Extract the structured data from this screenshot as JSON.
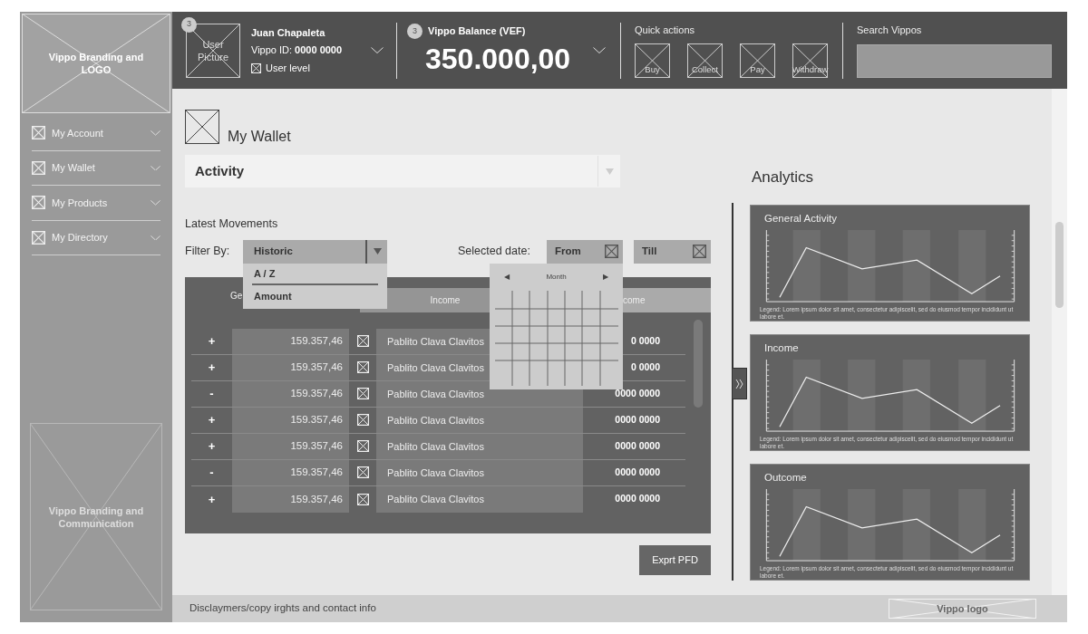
{
  "sidebar": {
    "logo": "Vippo Branding and LOGO",
    "items": [
      {
        "label": "My Account"
      },
      {
        "label": "My Wallet"
      },
      {
        "label": "My Products"
      },
      {
        "label": "My Directory"
      }
    ],
    "banner": "Vippo Branding and Communication"
  },
  "header": {
    "user": {
      "picture_label": "User Picture",
      "badge": "3",
      "name": "Juan Chapaleta",
      "id": "Vippo ID: **0000 0000**",
      "level": "User level"
    },
    "balance": {
      "badge": "3",
      "title": "Vippo Balance (VEF)",
      "amount": "350.000,00"
    },
    "quick_actions": {
      "title": "Quick actions",
      "actions": [
        "Buy",
        "Collect",
        "Pay",
        "Withdraw"
      ]
    },
    "search": {
      "title": "Search Vippos"
    }
  },
  "page": {
    "title": "My Wallet",
    "view_select": "Activity"
  },
  "movements": {
    "title": "Latest Movements",
    "filter_label": "Filter By:",
    "filter": {
      "value": "Historic",
      "expanded": true,
      "options": [
        "A / Z",
        "Amount"
      ]
    },
    "date_label": "Selected date:",
    "from": "From",
    "till": "Till",
    "calendar": {
      "open": true,
      "prev": "◀",
      "month": "Month",
      "next": "▶"
    },
    "columns": [
      "Ge",
      "Income",
      "come"
    ],
    "rows": [
      {
        "sign": "+",
        "amount": "159.357,46",
        "name": "Pablito Clava Clavitos",
        "id": "0 0000"
      },
      {
        "sign": "+",
        "amount": "159.357,46",
        "name": "Pablito Clava Clavitos",
        "id": "0 0000"
      },
      {
        "sign": "-",
        "amount": "159.357,46",
        "name": "Pablito Clava Clavitos",
        "id": "0000 0000"
      },
      {
        "sign": "+",
        "amount": "159.357,46",
        "name": "Pablito Clava Clavitos",
        "id": "0000 0000"
      },
      {
        "sign": "+",
        "amount": "159.357,46",
        "name": "Pablito Clava Clavitos",
        "id": "0000 0000"
      },
      {
        "sign": "-",
        "amount": "159.357,46",
        "name": "Pablito Clava Clavitos",
        "id": "0000 0000"
      },
      {
        "sign": "+",
        "amount": "159.357,46",
        "name": "Pablito Clava Clavitos",
        "id": "0000 0000"
      }
    ],
    "export": "Exprt PFD"
  },
  "analytics": {
    "title": "Analytics",
    "cards": [
      {
        "title": "General Activity",
        "legend": "Legend: Lorem ipsum dolor sit amet, consectetur adipiscelit, sed do eiusmod tempor incididunt ut labore et."
      },
      {
        "title": "Income",
        "legend": "Legend: Lorem ipsum dolor sit amet, consectetur adipiscelit, sed do eiusmod tempor incididunt ut labore et."
      },
      {
        "title": "Outcome",
        "legend": "Legend: Lorem ipsum dolor sit amet, consectetur adipiscelit, sed do eiusmod tempor incididunt ut labore et."
      }
    ]
  },
  "footer": {
    "text": "Disclaymers/copy irghts and contact info",
    "logo": "Vippo logo"
  }
}
